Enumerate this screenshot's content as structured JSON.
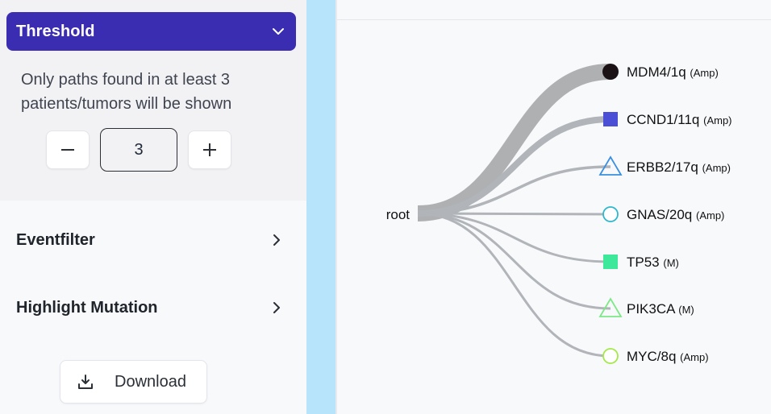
{
  "sidebar": {
    "threshold": {
      "title": "Threshold",
      "description": "Only paths found in at least 3 patients/tumors will be shown",
      "value": "3",
      "minus_label": "−",
      "plus_label": "+"
    },
    "items": [
      {
        "label": "Eventfilter"
      },
      {
        "label": "Highlight Mutation"
      }
    ],
    "download_label": "Download"
  },
  "tree": {
    "root_label": "root",
    "nodes": [
      {
        "name": "MDM4/1q",
        "type": "(Amp)",
        "shape": "circle-filled",
        "color": "#1b1216"
      },
      {
        "name": "CCND1/11q",
        "type": "(Amp)",
        "shape": "square-filled",
        "color": "#4a4fd6"
      },
      {
        "name": "ERBB2/17q",
        "type": "(Amp)",
        "shape": "triangle-outline",
        "color": "#3a8fe0"
      },
      {
        "name": "GNAS/20q",
        "type": "(Amp)",
        "shape": "circle-outline",
        "color": "#2fb7cc"
      },
      {
        "name": "TP53",
        "type": "(M)",
        "shape": "square-filled",
        "color": "#3ee89a"
      },
      {
        "name": "PIK3CA",
        "type": "(M)",
        "shape": "triangle-outline",
        "color": "#7de886"
      },
      {
        "name": "MYC/8q",
        "type": "(Amp)",
        "shape": "circle-outline",
        "color": "#a5e84a"
      }
    ],
    "colors": {
      "link": "#b1b4b8",
      "link_strong": "#aeb0b2"
    }
  },
  "colors": {
    "accent": "#3b2db2",
    "splitter": "#b8e4fb"
  }
}
